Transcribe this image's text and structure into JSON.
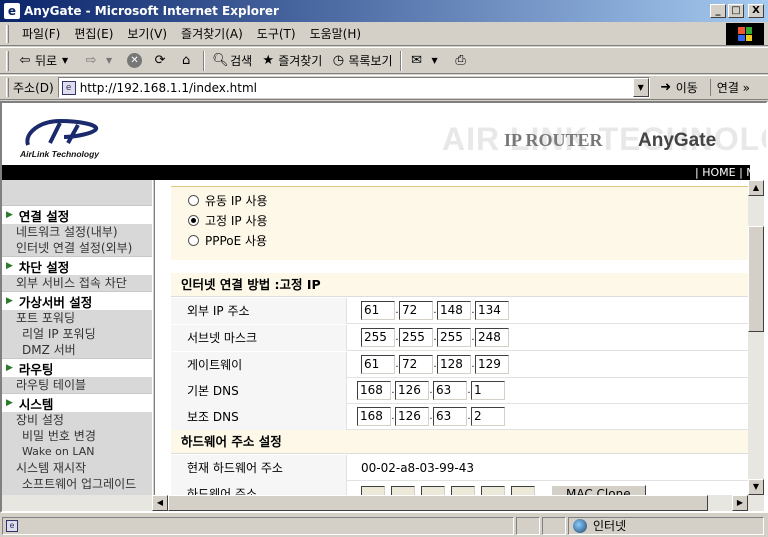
{
  "window": {
    "title": "AnyGate - Microsoft Internet Explorer",
    "min": "_",
    "max": "□",
    "close": "X"
  },
  "menu": [
    "파일(F)",
    "편집(E)",
    "보기(V)",
    "즐겨찾기(A)",
    "도구(T)",
    "도움말(H)"
  ],
  "toolbar": {
    "back": "뒤로",
    "search": "검색",
    "favorites": "즐겨찾기",
    "history": "목록보기"
  },
  "address": {
    "label": "주소(D)",
    "url": "http://192.168.1.1/index.html",
    "go": "이동",
    "links": "연결 »"
  },
  "header": {
    "brand": "AirLink Technology",
    "banner_bg": "AIR LINK TECHNOLOGY",
    "product": "IP ROUTER",
    "product_brand": "AnyGate",
    "top_links": "| HOME | MA"
  },
  "nav": [
    {
      "type": "section",
      "label": "연결 설정"
    },
    {
      "type": "item",
      "label": "네트워크 설정(내부)"
    },
    {
      "type": "item",
      "label": "인터넷 연결 설정(외부)"
    },
    {
      "type": "section",
      "label": "차단 설정"
    },
    {
      "type": "item",
      "label": "외부 서비스 접속 차단"
    },
    {
      "type": "section",
      "label": "가상서버 설정"
    },
    {
      "type": "item",
      "label": "포트 포워딩"
    },
    {
      "type": "sub",
      "label": "리얼 IP 포워딩"
    },
    {
      "type": "sub",
      "label": "DMZ 서버"
    },
    {
      "type": "section",
      "label": "라우팅"
    },
    {
      "type": "item",
      "label": "라우팅 테이블"
    },
    {
      "type": "section",
      "label": "시스템"
    },
    {
      "type": "item",
      "label": "장비 설정"
    },
    {
      "type": "sub",
      "label": "비밀 번호 변경"
    },
    {
      "type": "sub-small",
      "label": "Wake on LAN"
    },
    {
      "type": "item",
      "label": "시스템 재시작"
    },
    {
      "type": "sub",
      "label": "소프트웨어 업그레이드"
    }
  ],
  "connection": {
    "options": [
      {
        "label": "유동 IP 사용",
        "checked": false
      },
      {
        "label": "고정 IP 사용",
        "checked": true
      },
      {
        "label": "PPPoE 사용",
        "checked": false
      }
    ],
    "method_heading": "인터넷 연결 방법 :고정 IP",
    "rows": [
      {
        "label": "외부 IP 주소",
        "octets": [
          "61",
          "72",
          "148",
          "134"
        ]
      },
      {
        "label": "서브넷 마스크",
        "octets": [
          "255",
          "255",
          "255",
          "248"
        ]
      },
      {
        "label": "게이트웨이",
        "octets": [
          "61",
          "72",
          "128",
          "129"
        ]
      },
      {
        "label": "기본 DNS",
        "octets": [
          "168",
          "126",
          "63",
          "1"
        ]
      },
      {
        "label": "보조 DNS",
        "octets": [
          "168",
          "126",
          "63",
          "2"
        ]
      }
    ],
    "hw_heading": "하드웨어 주소 설정",
    "current_hw_label": "현재 하드웨어 주소",
    "current_hw_value": "00-02-a8-03-99-43",
    "hw_label": "하드웨어 주소",
    "mac_clone": "MAC Clone"
  },
  "status": {
    "zone": "인터넷"
  }
}
